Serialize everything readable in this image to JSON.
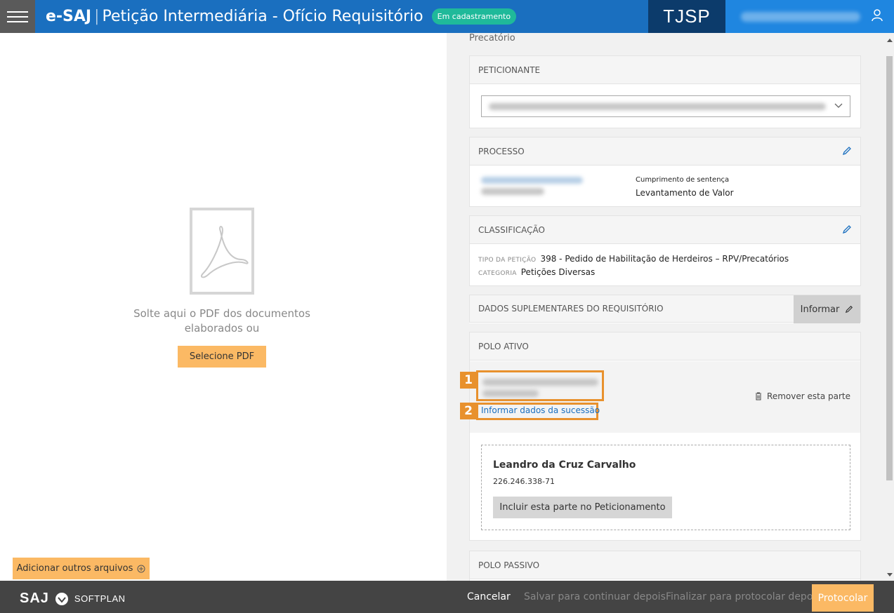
{
  "header": {
    "brand": "e-SAJ",
    "separator": "|",
    "title": "Petição Intermediária - Ofício Requisitório",
    "status": "Em cadastramento",
    "court": "TJSP"
  },
  "left": {
    "drop_text": "Solte aqui o PDF dos documentos elaborados ou",
    "select_button": "Selecione PDF",
    "add_files_button": "Adicionar outros arquivos"
  },
  "right": {
    "precatorio_label": "Precatório",
    "peticionante": {
      "heading": "PETICIONANTE"
    },
    "processo": {
      "heading": "PROCESSO",
      "classe": "Cumprimento de sentença",
      "assunto": "Levantamento de Valor"
    },
    "classificacao": {
      "heading": "CLASSIFICAÇÃO",
      "tipo_label": "TIPO DA PETIÇÃO",
      "tipo_value": "398 - Pedido de Habilitação de Herdeiros – RPV/Precatórios",
      "categoria_label": "CATEGORIA",
      "categoria_value": "Petições Diversas"
    },
    "dados_suplementares": {
      "heading": "DADOS SUPLEMENTARES DO REQUISITÓRIO",
      "button": "Informar"
    },
    "polo_ativo": {
      "heading": "POLO ATIVO",
      "marker_1": "1",
      "marker_2": "2",
      "sucessao_link": "Informar dados da sucessão",
      "remove_label": "Remover esta parte",
      "sucessor": {
        "name": "Leandro da Cruz Carvalho",
        "cpf": "226.246.338-71",
        "button": "Incluir esta parte no Peticionamento"
      }
    },
    "polo_passivo": {
      "heading": "POLO PASSIVO"
    }
  },
  "footer": {
    "logo_saj": "SAJ",
    "logo_softplan": "SOFTPLAN",
    "cancel": "Cancelar",
    "save": "Salvar para continuar depois",
    "finalize": "Finalizar para protocolar depois",
    "protocol": "Protocolar"
  },
  "colors": {
    "header_blue": "#1a6fbf",
    "court_navy": "#0c3b6b",
    "accent_orange": "#fbb964",
    "highlight_orange": "#e8912d",
    "status_green": "#1fb99a"
  }
}
